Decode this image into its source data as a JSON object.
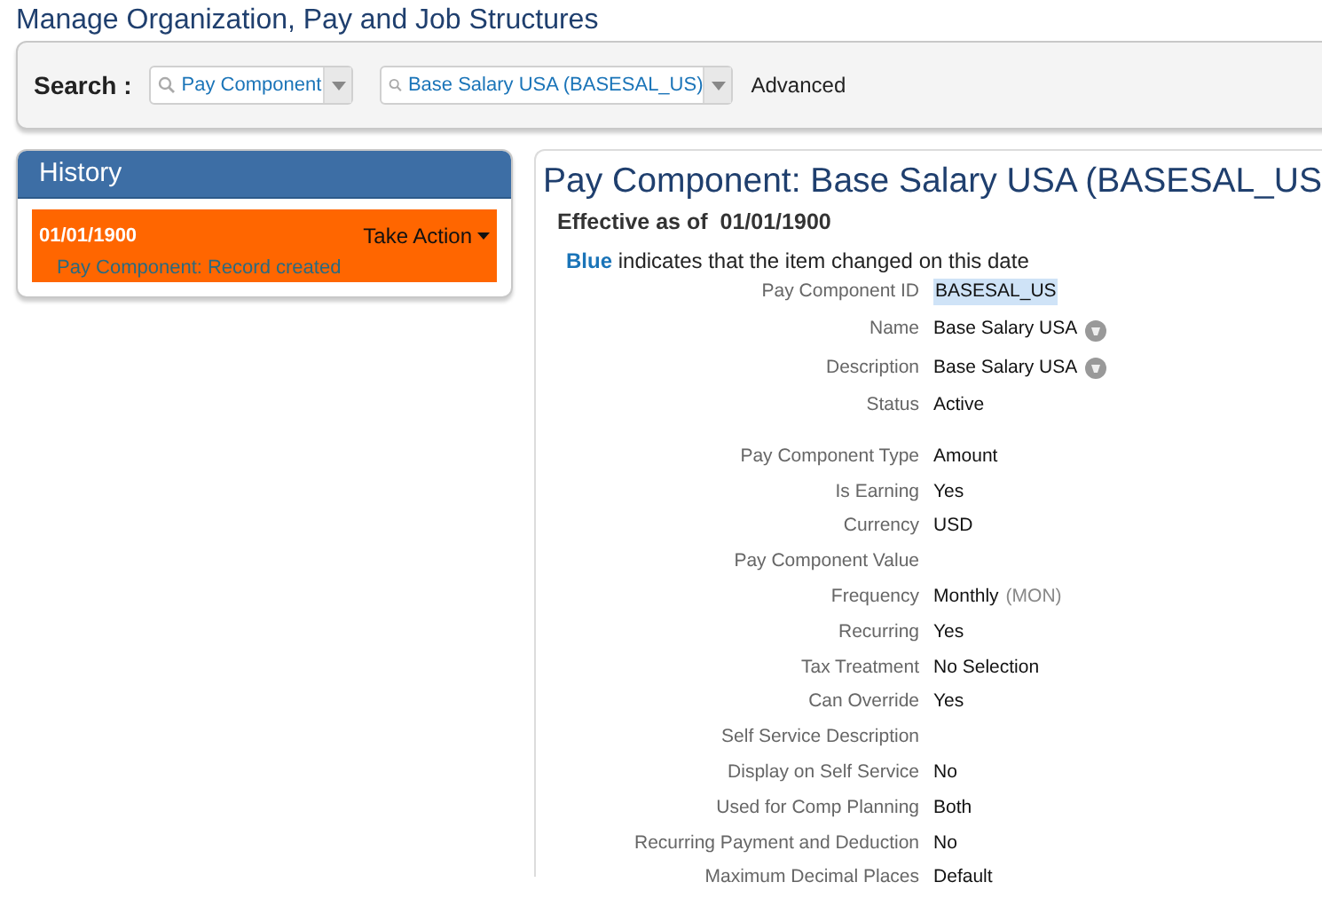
{
  "page_title": "Manage Organization, Pay and Job Structures",
  "search": {
    "label": "Search :",
    "type_field": {
      "value": "Pay Component"
    },
    "item_field": {
      "value": "Base Salary USA (BASESAL_US)"
    },
    "advanced": "Advanced"
  },
  "history": {
    "title": "History",
    "entries": [
      {
        "date": "01/01/1900",
        "action": "Take Action",
        "note": "Pay Component: Record created",
        "selected": true
      }
    ]
  },
  "detail": {
    "title": "Pay Component: Base Salary USA (BASESAL_US",
    "effective_label": "Effective as of",
    "effective_date": "01/01/1900",
    "legend_key": "Blue",
    "legend_text": "indicates that the item changed on this date",
    "sections": [
      {
        "fields": [
          {
            "label": "Pay Component ID",
            "value": "BASESAL_US",
            "highlighted": true,
            "info_icon": false
          },
          {
            "label": "Name",
            "value": "Base Salary USA",
            "highlighted": false,
            "info_icon": true
          },
          {
            "label": "Description",
            "value": "Base Salary USA",
            "highlighted": false,
            "info_icon": true
          },
          {
            "label": "Status",
            "value": "Active",
            "highlighted": false,
            "info_icon": false
          }
        ]
      },
      {
        "fields": [
          {
            "label": "Pay Component Type",
            "value": "Amount",
            "highlighted": false,
            "info_icon": false
          },
          {
            "label": "Is Earning",
            "value": "Yes",
            "highlighted": false,
            "info_icon": false
          },
          {
            "label": "Currency",
            "value": "USD",
            "highlighted": false,
            "info_icon": false
          },
          {
            "label": "Pay Component Value",
            "highlighted": false,
            "info_icon": false
          },
          {
            "label": "Frequency",
            "value": "Monthly",
            "code": "(MON)",
            "highlighted": false,
            "info_icon": false
          },
          {
            "label": "Recurring",
            "value": "Yes",
            "highlighted": false,
            "info_icon": false
          },
          {
            "label": "Tax Treatment",
            "value": "No Selection",
            "highlighted": false,
            "info_icon": false
          },
          {
            "label": "Can Override",
            "value": "Yes",
            "highlighted": false,
            "info_icon": false
          },
          {
            "label": "Self Service Description",
            "highlighted": false,
            "info_icon": false
          },
          {
            "label": "Display on Self Service",
            "value": "No",
            "highlighted": false,
            "info_icon": false
          },
          {
            "label": "Used for Comp Planning",
            "value": "Both",
            "highlighted": false,
            "info_icon": false
          },
          {
            "label": "Recurring Payment and Deduction",
            "value": "No",
            "highlighted": false,
            "info_icon": false
          },
          {
            "label": "Maximum Decimal Places",
            "value": "Default",
            "highlighted": false,
            "info_icon": false
          }
        ]
      }
    ]
  }
}
